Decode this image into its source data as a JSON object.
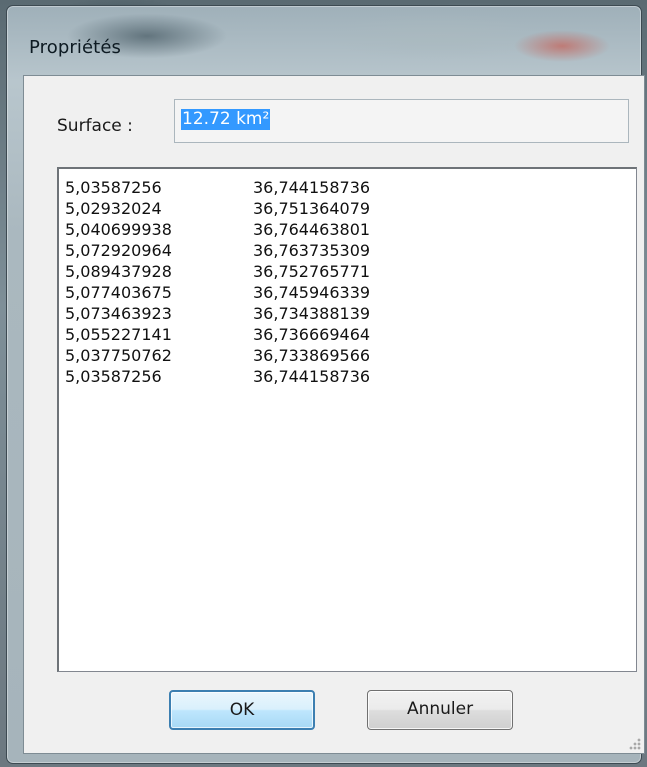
{
  "window": {
    "title": "Propriétés"
  },
  "surface": {
    "label": "Surface :",
    "value": "12.72 km²"
  },
  "coordinates": [
    {
      "x": "5,03587256",
      "y": "36,744158736"
    },
    {
      "x": "5,02932024",
      "y": "36,751364079"
    },
    {
      "x": "5,040699938",
      "y": "36,764463801"
    },
    {
      "x": "5,072920964",
      "y": "36,763735309"
    },
    {
      "x": "5,089437928",
      "y": "36,752765771"
    },
    {
      "x": "5,077403675",
      "y": "36,745946339"
    },
    {
      "x": "5,073463923",
      "y": "36,734388139"
    },
    {
      "x": "5,055227141",
      "y": "36,736669464"
    },
    {
      "x": "5,037750762",
      "y": "36,733869566"
    },
    {
      "x": "5,03587256",
      "y": "36,744158736"
    }
  ],
  "buttons": {
    "ok_label": "OK",
    "cancel_label": "Annuler"
  },
  "colors": {
    "selection": "#3399ff",
    "default_button_border": "#3c7fb1"
  }
}
